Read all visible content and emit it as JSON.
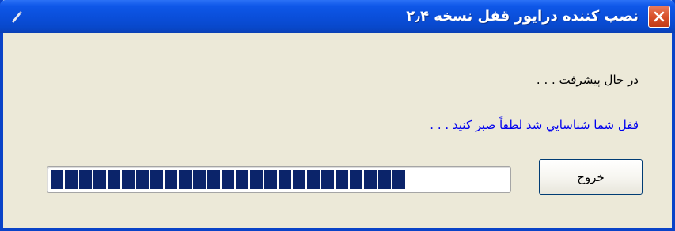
{
  "window": {
    "title": "نصب کننده درایور قفل نسخه ۲٫۴"
  },
  "content": {
    "status_text": "در حال پیشرفت . . .",
    "message_text": "قفل شما شناسايي شد لطفاً صبر کنيد . . .",
    "exit_label": "خروج"
  },
  "progress": {
    "percent": 0.77
  },
  "icons": {
    "app": "setup-icon",
    "close": "close-icon"
  },
  "colors": {
    "titlebar": "#0a4ed9",
    "body": "#ece9d8",
    "progress_fill": "#0b246a",
    "message": "#0000ee",
    "close": "#d9512b"
  }
}
